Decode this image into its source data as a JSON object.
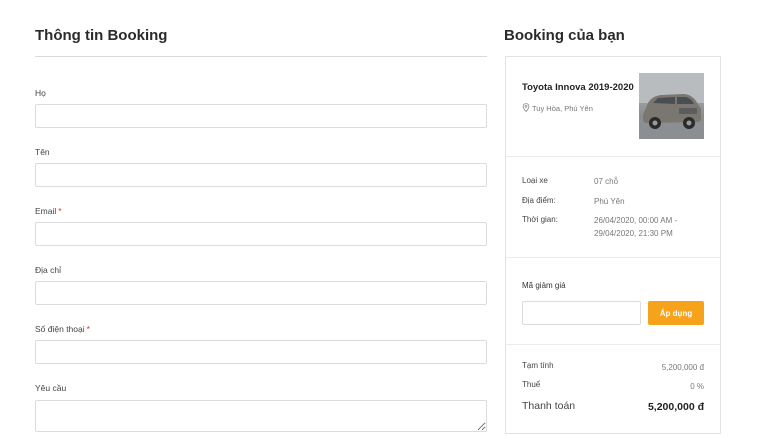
{
  "booking_form": {
    "title": "Thông tin Booking",
    "fields": [
      {
        "label": "Họ",
        "required": false,
        "value": "",
        "placeholder": ""
      },
      {
        "label": "Tên",
        "required": false,
        "value": "",
        "placeholder": ""
      },
      {
        "label": "Email",
        "required": true,
        "value": "",
        "placeholder": ""
      },
      {
        "label": "Địa chỉ",
        "required": false,
        "value": "",
        "placeholder": ""
      },
      {
        "label": "Số điện thoại",
        "required": true,
        "value": "",
        "placeholder": ""
      },
      {
        "label": "Yêu cầu",
        "required": false,
        "value": "",
        "placeholder": ""
      }
    ],
    "required_mark": "*"
  },
  "summary": {
    "title": "Booking của bạn",
    "car": {
      "name": "Toyota Innova 2019-2020",
      "location": "Tuy Hòa, Phú Yên",
      "image_icon": "car-photo"
    },
    "details": [
      {
        "label": "Loại xe",
        "value": "07 chỗ"
      },
      {
        "label": "Địa điểm:",
        "value": "Phú Yên"
      },
      {
        "label": "Thời gian:",
        "value": "26/04/2020, 00:00 AM - 29/04/2020, 21:30 PM"
      }
    ],
    "coupon": {
      "label": "Mã giảm giá",
      "value": "",
      "button_label": "Áp dụng"
    },
    "subtotal": {
      "label": "Tạm tính",
      "value": "5,200,000 đ"
    },
    "tax": {
      "label": "Thuế",
      "value": "0 %"
    },
    "total": {
      "label": "Thanh toán",
      "value": "5,200,000 đ"
    }
  },
  "colors": {
    "accent": "#f7a21b",
    "required": "#e03131",
    "border": "#dcdcdc"
  }
}
